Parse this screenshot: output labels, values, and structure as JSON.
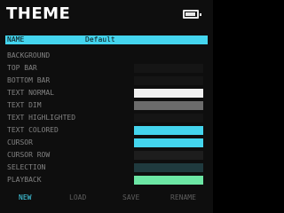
{
  "header": {
    "title": "THEME",
    "battery_icon": "battery-icon"
  },
  "name_field": {
    "label": "NAME",
    "value": "Default"
  },
  "items": [
    {
      "label": "BACKGROUND",
      "color": ""
    },
    {
      "label": "TOP BAR",
      "color": "#151515"
    },
    {
      "label": "BOTTOM BAR",
      "color": "#151515"
    },
    {
      "label": "TEXT NORMAL",
      "color": "#f0f0f0"
    },
    {
      "label": "TEXT DIM",
      "color": "#6b6b6b"
    },
    {
      "label": "TEXT HIGHLIGHTED",
      "color": "#151515"
    },
    {
      "label": "TEXT COLORED",
      "color": "#44d5ee"
    },
    {
      "label": "CURSOR",
      "color": "#44d5ee"
    },
    {
      "label": "CURSOR ROW",
      "color": "#1d1d1d"
    },
    {
      "label": "SELECTION",
      "color": "#1f3a3e"
    },
    {
      "label": "PLAYBACK",
      "color": "#6ce6a4"
    }
  ],
  "footer": {
    "buttons": [
      {
        "label": "NEW",
        "active": true
      },
      {
        "label": "LOAD",
        "active": false
      },
      {
        "label": "SAVE",
        "active": false
      },
      {
        "label": "RENAME",
        "active": false
      }
    ]
  },
  "colors": {
    "accent": "#44d5ee",
    "background": "#0e0e0e"
  }
}
